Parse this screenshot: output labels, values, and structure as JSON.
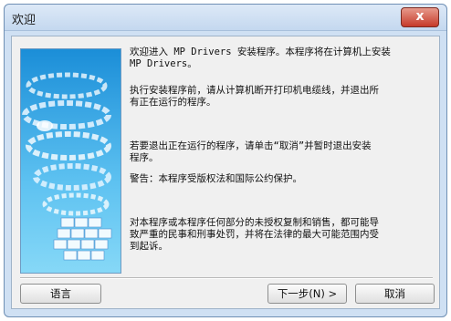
{
  "window": {
    "title": "欢迎",
    "close_label": "x"
  },
  "main": {
    "paragraphs": [
      "欢迎进入 MP Drivers 安装程序。本程序将在计算机上安装\nMP Drivers。",
      "执行安装程序前，请从计算机断开打印机电缆线，并退出所\n有正在运行的程序。",
      "若要退出正在运行的程序，请单击“取消”并暂时退出安装\n程序。",
      "警告：本程序受版权法和国际公约保护。",
      "对本程序或本程序任何部分的未授权复制和销售，都可能导\n致严重的民事和刑事处罚，并将在法律的最大可能范围内受\n到起诉。"
    ]
  },
  "buttons": {
    "language": "语言",
    "next": "下一步(N) >",
    "cancel": "取消"
  },
  "colors": {
    "frame": "#cfe0f3",
    "close_button": "#c63a2a",
    "art_top": "#1b8ed8"
  }
}
